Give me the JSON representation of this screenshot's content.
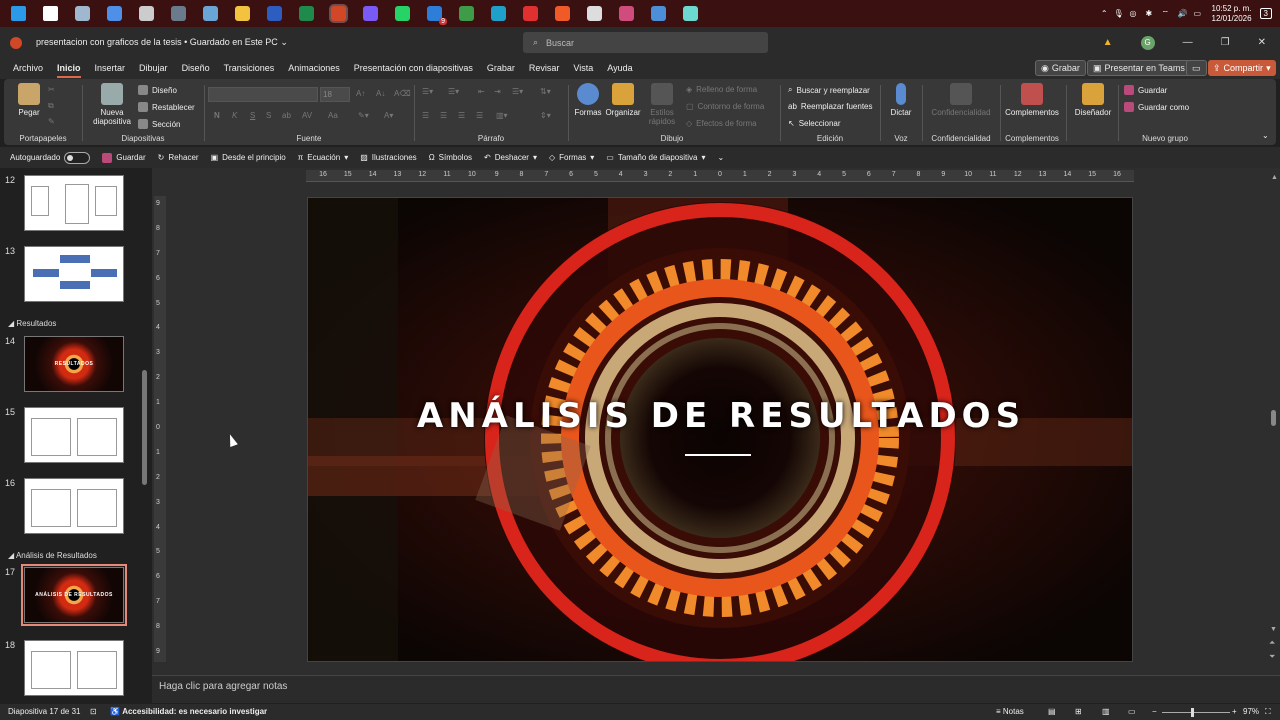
{
  "taskbar": {
    "icons": [
      {
        "name": "windows-start-icon",
        "color": "#2b9be8"
      },
      {
        "name": "search-icon",
        "color": "#ffffff"
      },
      {
        "name": "file-manager-icon",
        "color": "#9fb8d0"
      },
      {
        "name": "copilot-icon",
        "color": "#4e8fe8"
      },
      {
        "name": "settings-app-icon",
        "color": "#cccccc"
      },
      {
        "name": "calculator-icon",
        "color": "#6a7c8c"
      },
      {
        "name": "photos-icon",
        "color": "#6aa5d8"
      },
      {
        "name": "explorer-icon",
        "color": "#f3c340"
      },
      {
        "name": "word-icon",
        "color": "#2b5ec0"
      },
      {
        "name": "excel-icon",
        "color": "#1e8a4c"
      },
      {
        "name": "powerpoint-icon",
        "color": "#d24726"
      },
      {
        "name": "messenger-icon",
        "color": "#7a5af5"
      },
      {
        "name": "whatsapp-icon",
        "color": "#25d366"
      },
      {
        "name": "app-badge-icon",
        "color": "#2d7ed8"
      },
      {
        "name": "chrome-icon",
        "color": "#3e9b48"
      },
      {
        "name": "edge-icon",
        "color": "#1ea0c8"
      },
      {
        "name": "opera-icon",
        "color": "#e03030"
      },
      {
        "name": "brave-icon",
        "color": "#f05a28"
      },
      {
        "name": "obs-icon",
        "color": "#dddddd"
      },
      {
        "name": "capture-tool-icon",
        "color": "#d04c7c"
      },
      {
        "name": "remote-desktop-icon",
        "color": "#4c8fd8"
      },
      {
        "name": "screen-app-icon",
        "color": "#6cd8d0"
      }
    ],
    "badge": "9",
    "clock_time": "10:52 p. m.",
    "clock_date": "12/01/2026",
    "notif_count": "3"
  },
  "titlebar": {
    "doc_title": "presentacion con graficos de la tesis",
    "save_status": "Guardado en Este PC",
    "search_placeholder": "Buscar",
    "avatar": "G"
  },
  "menu": {
    "tabs": [
      "Archivo",
      "Inicio",
      "Insertar",
      "Dibujar",
      "Diseño",
      "Transiciones",
      "Animaciones",
      "Presentación con diapositivas",
      "Grabar",
      "Revisar",
      "Vista",
      "Ayuda"
    ],
    "selected": "Inicio",
    "record_btn": "Grabar",
    "teams_btn": "Presentar en Teams",
    "share_btn": "Compartir"
  },
  "ribbon": {
    "portapapeles": {
      "label": "Portapapeles",
      "paste": "Pegar"
    },
    "diapositivas": {
      "label": "Diapositivas",
      "new_slide": "Nueva diapositiva",
      "layout": "Diseño",
      "reset": "Restablecer",
      "section": "Sección"
    },
    "fuente": {
      "label": "Fuente",
      "size": "18",
      "bold": "N",
      "italic": "K",
      "underline": "S",
      "strike": "S"
    },
    "parrafo": {
      "label": "Párrafo"
    },
    "dibujo": {
      "label": "Dibujo",
      "shapes": "Formas",
      "arrange": "Organizar",
      "quick_styles": "Estilos rápidos",
      "fill": "Relleno de forma",
      "outline": "Contorno de forma",
      "effects": "Efectos de forma"
    },
    "edicion": {
      "label": "Edición",
      "find": "Buscar y reemplazar",
      "replace_fonts": "Reemplazar fuentes",
      "select": "Seleccionar"
    },
    "voz": {
      "label": "Voz",
      "dictate": "Dictar"
    },
    "confidencialidad": {
      "label": "Confidencialidad",
      "btn": "Confidencialidad"
    },
    "complementos": {
      "label": "Complementos",
      "btn": "Complementos"
    },
    "designer": {
      "btn": "Diseñador"
    },
    "nuevo_grupo": {
      "label": "Nuevo grupo",
      "save": "Guardar",
      "save_as": "Guardar como"
    }
  },
  "qat": {
    "autosave": "Autoguardado",
    "save": "Guardar",
    "redo": "Rehacer",
    "from_start": "Desde el principio",
    "equation": "Ecuación",
    "illustrations": "Ilustraciones",
    "symbols": "Símbolos",
    "undo": "Deshacer",
    "shapes": "Formas",
    "slide_size": "Tamaño de diapositiva"
  },
  "thumbnails": {
    "sections": {
      "resultados": "Resultados",
      "analisis": "Análisis de Resultados"
    },
    "slides": [
      {
        "n": "12",
        "kind": "diagram"
      },
      {
        "n": "13",
        "kind": "flow"
      },
      {
        "n": "14",
        "kind": "title",
        "title": "RESULTADOS"
      },
      {
        "n": "15",
        "kind": "chart"
      },
      {
        "n": "16",
        "kind": "chart"
      },
      {
        "n": "17",
        "kind": "title",
        "title": "ANÁLISIS DE RESULTADOS",
        "selected": true
      },
      {
        "n": "18",
        "kind": "chart"
      }
    ]
  },
  "ruler": {
    "h": [
      "16",
      "15",
      "14",
      "13",
      "12",
      "11",
      "10",
      "9",
      "8",
      "7",
      "6",
      "5",
      "4",
      "3",
      "2",
      "1",
      "0",
      "1",
      "2",
      "3",
      "4",
      "5",
      "6",
      "7",
      "8",
      "9",
      "10",
      "11",
      "12",
      "13",
      "14",
      "15",
      "16"
    ],
    "v": [
      "9",
      "8",
      "7",
      "6",
      "5",
      "4",
      "3",
      "2",
      "1",
      "0",
      "1",
      "2",
      "3",
      "4",
      "5",
      "6",
      "7",
      "8",
      "9"
    ]
  },
  "slide": {
    "title": "ANÁLISIS DE RESULTADOS"
  },
  "notes": {
    "placeholder": "Haga clic para agregar notas"
  },
  "status": {
    "slide_counter": "Diapositiva 17 de 31",
    "accessibility": "Accesibilidad: es necesario investigar",
    "notes_btn": "Notas",
    "zoom": "97%"
  }
}
